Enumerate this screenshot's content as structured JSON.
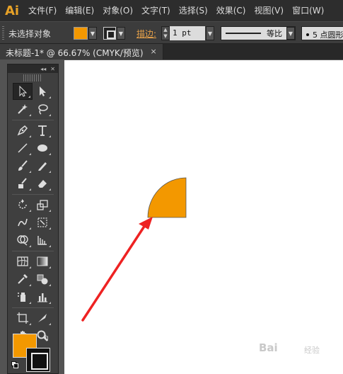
{
  "app": {
    "logo": "Ai"
  },
  "menu": [
    "文件(F)",
    "编辑(E)",
    "对象(O)",
    "文字(T)",
    "选择(S)",
    "效果(C)",
    "视图(V)",
    "窗口(W)"
  ],
  "control_bar": {
    "selection_status": "未选择对象",
    "fill_color": "#f39800",
    "stroke_label": "描边:",
    "stroke_weight": "1 pt",
    "profile_label": "等比",
    "brush_label": "5 点圆形"
  },
  "document_tab": {
    "title": "未标题-1* @ 66.67% (CMYK/预览)",
    "close": "×"
  },
  "toolbox": {
    "header_collapse": "◂◂",
    "header_close": "✕",
    "fill_color": "#f39800",
    "stroke_color": "#111111",
    "swap": "↰"
  },
  "artwork": {
    "shape": "quarter-circle",
    "shape_fill": "#f39800",
    "arrow_color": "#ee2222"
  },
  "watermark": {
    "text": "Bai",
    "sub": "经验"
  }
}
